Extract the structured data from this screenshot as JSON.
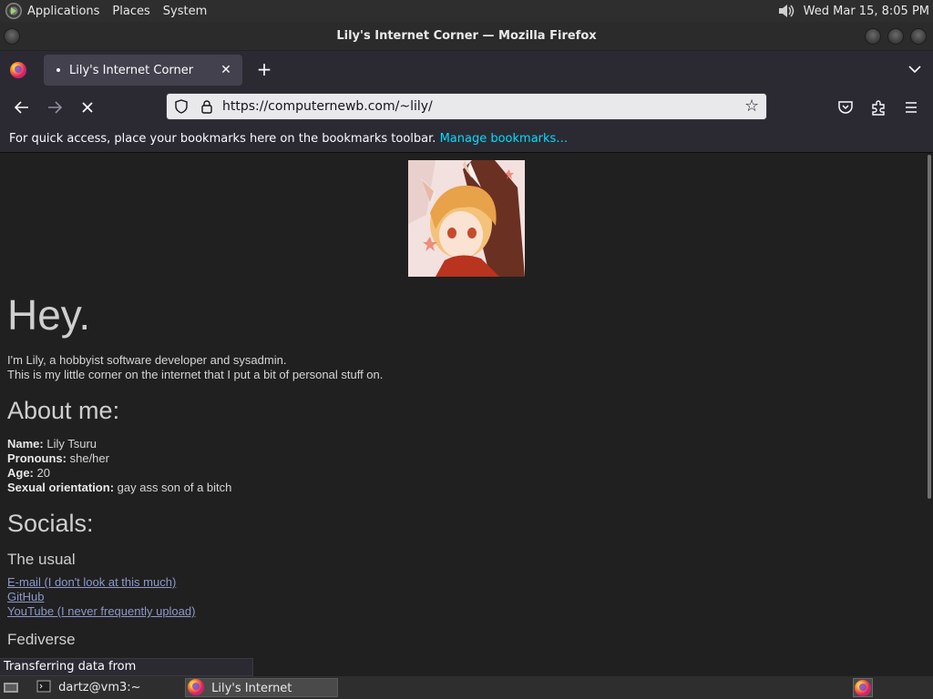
{
  "top_panel": {
    "menus": [
      "Applications",
      "Places",
      "System"
    ],
    "clock": "Wed Mar 15,  8:05 PM"
  },
  "window": {
    "title": "Lily's Internet Corner — Mozilla Firefox"
  },
  "browser": {
    "tab_title": "Lily's Internet Corner",
    "url": "https://computernewb.com/~lily/",
    "bookmarks_text": "For quick access, place your bookmarks here on the bookmarks toolbar.",
    "bookmarks_link": "Manage bookmarks…",
    "status_text": "Transferring data from computernewb.com…"
  },
  "page": {
    "heading": "Hey.",
    "intro_line1": "I'm Lily, a hobbyist software developer and sysadmin.",
    "intro_line2": "This is my little corner on the internet that I put a bit of personal stuff on.",
    "about_heading": "About me:",
    "about": {
      "name_label": "Name:",
      "name_value": " Lily Tsuru",
      "pronouns_label": "Pronouns:",
      "pronouns_value": " she/her",
      "age_label": "Age:",
      "age_value": " 20",
      "orientation_label": "Sexual orientation:",
      "orientation_value": " gay ass son of a bitch"
    },
    "socials_heading": "Socials:",
    "usual_heading": "The usual",
    "links": [
      "E-mail (I don't look at this much)",
      "GitHub",
      "YouTube (I never frequently upload)"
    ],
    "fediverse_heading": "Fediverse"
  },
  "taskbar": {
    "terminal_label": "dartz@vm3:~",
    "firefox_label": "Lily's Internet Corne..."
  }
}
